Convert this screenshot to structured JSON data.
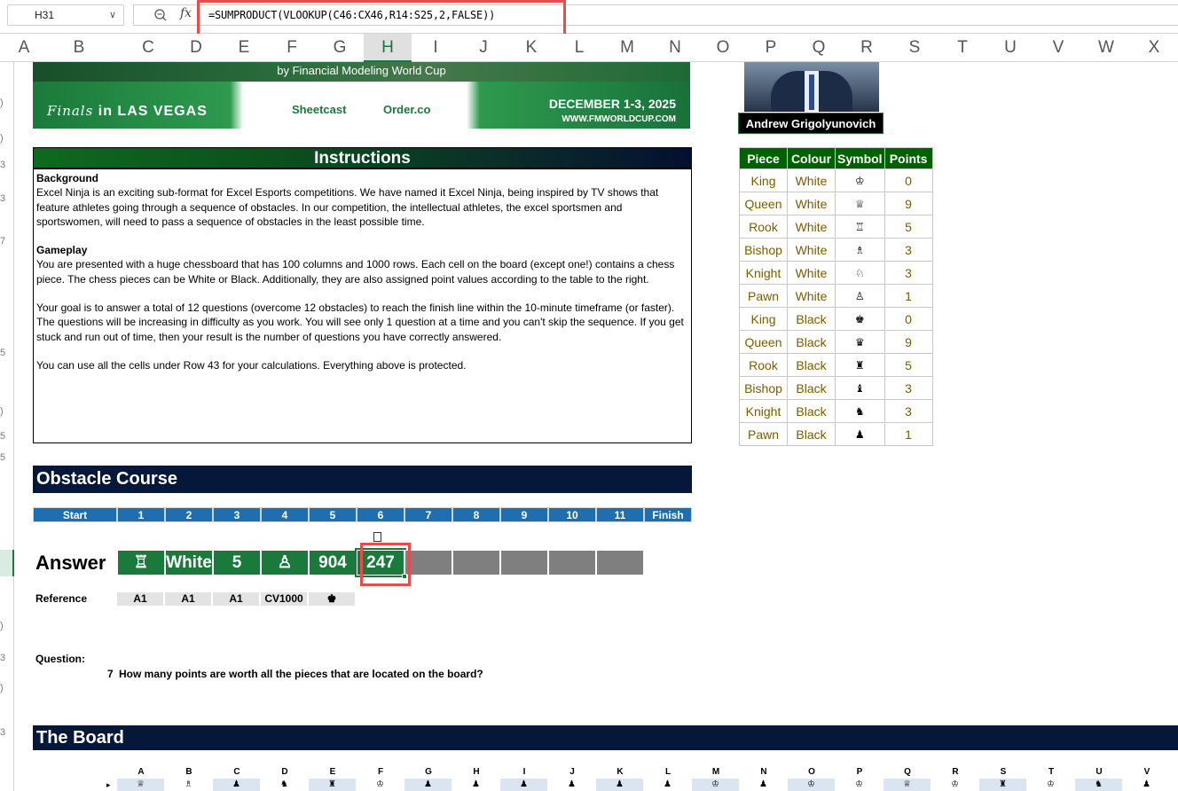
{
  "formula_bar": {
    "cell_ref": "H31",
    "formula": "=SUMPRODUCT(VLOOKUP(C46:CX46,R14:S25,2,FALSE))"
  },
  "columns": [
    "A",
    "B",
    "C",
    "D",
    "E",
    "F",
    "G",
    "H",
    "I",
    "J",
    "K",
    "L",
    "M",
    "N",
    "O",
    "P",
    "Q",
    "R",
    "S",
    "T",
    "U",
    "V",
    "W",
    "X"
  ],
  "selected_column": "H",
  "banner": {
    "by_line": "by Financial Modeling World Cup",
    "finals": "Finals",
    "finals_in": "in LAS VEGAS",
    "sponsor1": "Sheetcast",
    "sponsor2": "Order.co",
    "dates": "DECEMBER 1-3, 2025",
    "website": "WWW.FMWORLDCUP.COM"
  },
  "judge_name": "Andrew Grigolyunovich",
  "instructions": {
    "title": "Instructions",
    "background_heading": "Background",
    "background_text": "Excel Ninja is an exciting sub-format for Excel Esports competitions. We have named it Excel Ninja, being inspired by TV shows that feature athletes going through a sequence of obstacles. In our competition, the intellectual athletes, the excel sportsmen and sportswomen, will need to pass a sequence of obstacles in the least possible time.",
    "gameplay_heading": "Gameplay",
    "gameplay_text": "You are presented with a huge chessboard that has 100 columns and 1000 rows. Each cell on the board (except one!) contains a chess piece. The chess pieces can be White or Black. Additionally, they are also assigned point values according to the table to the right.",
    "goal_text": "Your goal is to answer a total of 12 questions (overcome 12 obstacles) to reach the finish line within the 10-minute timeframe (or faster). The questions will be increasing in difficulty as you work. You will see only 1 question at a time and you can't skip the sequence. If you get stuck and run out of time, then your result is the number of questions you have correctly answered.",
    "cells_text": "You can use all the cells under Row 43 for your calculations. Everything above is protected."
  },
  "piece_table": {
    "headers": [
      "Piece",
      "Colour",
      "Symbol",
      "Points"
    ],
    "rows": [
      [
        "King",
        "White",
        "♔",
        "0"
      ],
      [
        "Queen",
        "White",
        "♕",
        "9"
      ],
      [
        "Rook",
        "White",
        "♖",
        "5"
      ],
      [
        "Bishop",
        "White",
        "♗",
        "3"
      ],
      [
        "Knight",
        "White",
        "♘",
        "3"
      ],
      [
        "Pawn",
        "White",
        "♙",
        "1"
      ],
      [
        "King",
        "Black",
        "♚",
        "0"
      ],
      [
        "Queen",
        "Black",
        "♛",
        "9"
      ],
      [
        "Rook",
        "Black",
        "♜",
        "5"
      ],
      [
        "Bishop",
        "Black",
        "♝",
        "3"
      ],
      [
        "Knight",
        "Black",
        "♞",
        "3"
      ],
      [
        "Pawn",
        "Black",
        "♟",
        "1"
      ]
    ]
  },
  "obstacle": {
    "title": "Obstacle Course",
    "steps": [
      "Start",
      "1",
      "2",
      "3",
      "4",
      "5",
      "6",
      "7",
      "8",
      "9",
      "10",
      "11",
      "Finish"
    ],
    "answer_label": "Answer",
    "answers": [
      "♖",
      "White",
      "5",
      "♙",
      "904",
      "247",
      "",
      "",
      "",
      "",
      ""
    ],
    "reference_label": "Reference",
    "references": [
      "A1",
      "A1",
      "A1",
      "CV1000",
      "♚"
    ],
    "question_label": "Question:",
    "question_number": "7",
    "question_text": "How many points are worth all the pieces that are located on the board?"
  },
  "board": {
    "title": "The Board",
    "columns": [
      "A",
      "B",
      "C",
      "D",
      "E",
      "F",
      "G",
      "H",
      "I",
      "J",
      "K",
      "L",
      "M",
      "N",
      "O",
      "P",
      "Q",
      "R",
      "S",
      "T",
      "U",
      "V"
    ],
    "first_row": [
      "♕",
      "♗",
      "♟",
      "♞",
      "♜",
      "♔",
      "♟",
      "♟",
      "♟",
      "♟",
      "♟",
      "♟",
      "♔",
      "♟",
      "♔",
      "♔",
      "♕",
      "♔",
      "♜",
      "♔",
      "♞",
      "♟"
    ]
  },
  "colors": {
    "accent_green": "#1a7a3b",
    "navy": "#05183a",
    "step_blue": "#1f6fb0",
    "highlight_red": "#e94c4c"
  }
}
